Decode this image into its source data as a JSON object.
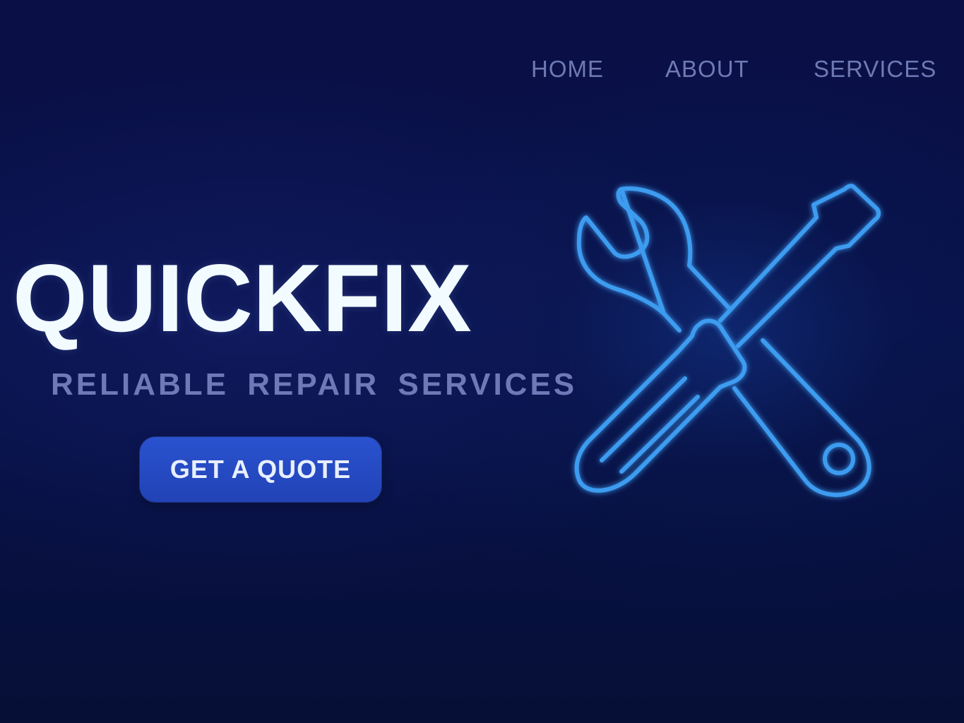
{
  "nav": {
    "items": [
      {
        "label": "HOME"
      },
      {
        "label": "ABOUT"
      },
      {
        "label": "SERVICES"
      }
    ]
  },
  "hero": {
    "title": "QUICKFIX",
    "tagline": "RELIABLE REPAIR SERVICES",
    "cta_label": "GET A QUOTE"
  },
  "illustration": {
    "icon": "wrench-and-screwdriver-icon"
  },
  "colors": {
    "background": "#08124a",
    "nav_text": "#6f79b3",
    "title": "#f2fbff",
    "tagline": "#6f79b8",
    "button": "#2448c0",
    "icon_stroke": "#3d9cf0"
  }
}
